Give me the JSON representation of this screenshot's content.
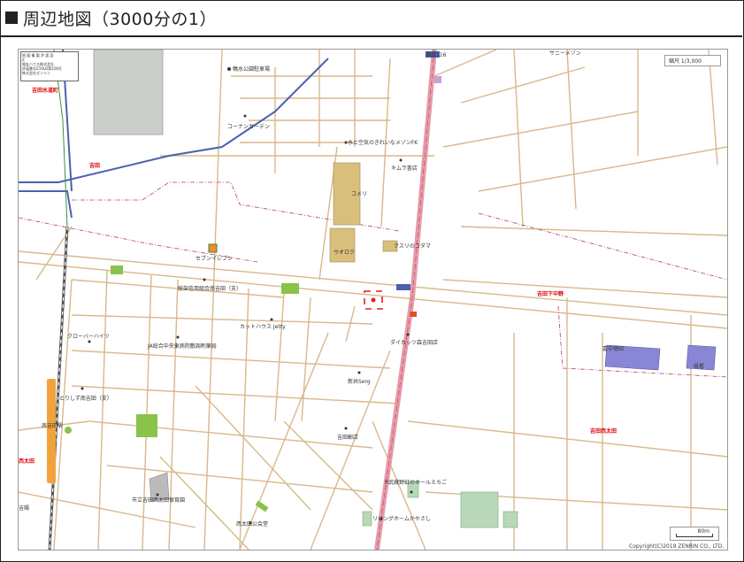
{
  "header": {
    "title": "周辺地図（3000分の1）"
  },
  "map": {
    "scale_text": "縮尺 1/3,000",
    "scale_bar_label": "80m",
    "copyright": "Copyright(C)2019 ZENRIN CO., LTD.",
    "corner_box": {
      "line1": "地 図 複 製 許 諾 証",
      "line2": "Z",
      "line3": "電友ハウス株式会社",
      "line4": "許諾番号Z19LD第228号",
      "line5": "株式会社ゼンリン"
    },
    "labels": {
      "park": "鴨水公園駐車場",
      "konan": "コーナンガーデン",
      "water": "水と空気のきれいなメゾンFK",
      "kimura": "キムラ書店",
      "komeri": "コメリ",
      "uoroku": "ウオロク",
      "kusuri": "クスリのコダマ",
      "seven": "セブンイレブン",
      "school1": "総架信用組合南吉田（支）",
      "kutto": "カットハウス Jetty",
      "crown": "クローバーハイツ",
      "pharmacy": "JA総合中央東病院敷調剤薬局",
      "daikatsu": "ダイカッツ森吉田店",
      "ninomiya": "新井Serg",
      "yoshida_post": "吉田郵店",
      "toride": "とりしず南吉田（支）",
      "musashi": "R武蔵野虹のホールえちご",
      "living": "リビングホームかやさし",
      "city_hall": "市立吉田西太田保育園",
      "west_park": "西太田公会堂",
      "sunnymezon": "サニーメゾン",
      "yoshida_town": "吉田",
      "yoshida_mizu": "吉田水道町",
      "yoshida_shimo": "吉田下中野",
      "yoshida_nishiota": "吉田西太田",
      "nishiota": "西太田",
      "station": "南吉田駅",
      "hospital": "嘉中徳田",
      "shrine": "県看",
      "kenhama": "国道116",
      "left_bottom": "吉陽"
    },
    "colors": {
      "road": "#c9a164",
      "major_road": "#e79aa8",
      "rail": "#5a6fb5",
      "park": "#89c34a",
      "building_tan": "#d9bf7c",
      "building_purple": "#8a86d6",
      "building_green": "#b9d8b9",
      "building_gray": "#c9cec9",
      "marker": "#e02020",
      "label_red": "#dd0000"
    }
  }
}
